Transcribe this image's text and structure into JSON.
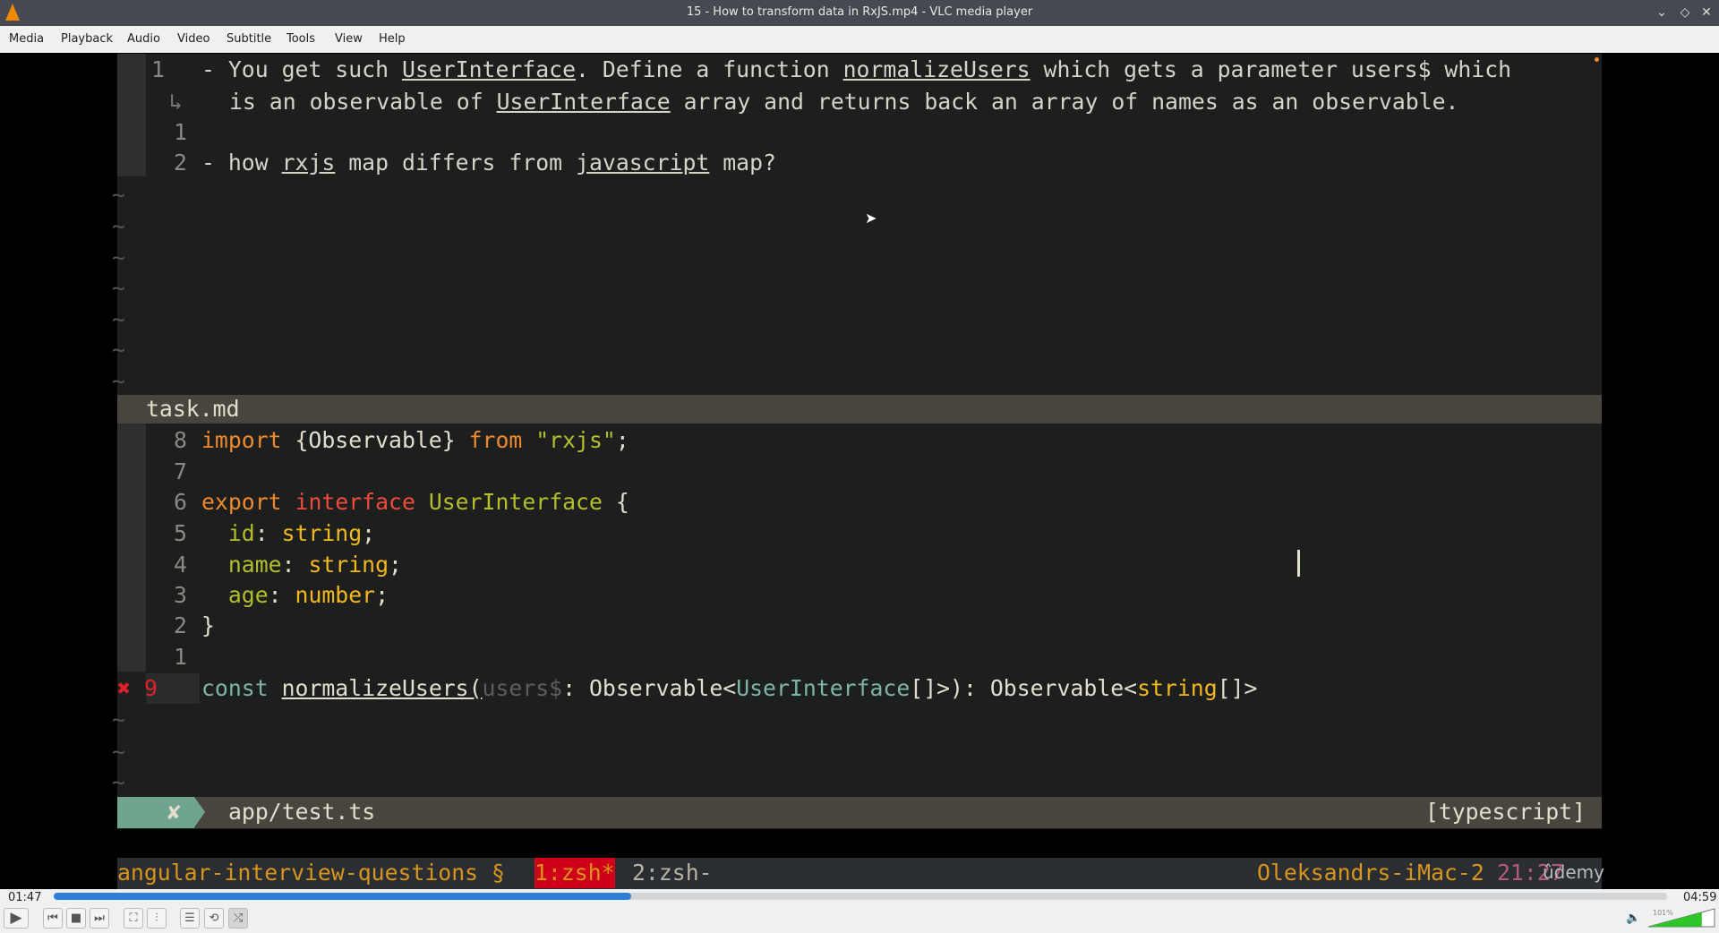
{
  "window": {
    "title": "15 - How to transform data in RxJS.mp4 - VLC media player"
  },
  "menu": [
    "Media",
    "Playback",
    "Audio",
    "Video",
    "Subtitle",
    "Tools",
    "View",
    "Help"
  ],
  "editor": {
    "top_pane": [
      {
        "num": "1",
        "tokens": [
          {
            "t": "- You get such ",
            "c": "#d6d3c8"
          },
          {
            "t": "UserInterface",
            "c": "#d6d3c8",
            "u": true
          },
          {
            "t": ". Define a function ",
            "c": "#d6d3c8"
          },
          {
            "t": "normalizeUsers",
            "c": "#d6d3c8",
            "u": true
          },
          {
            "t": " which gets a parameter users$ which",
            "c": "#d6d3c8"
          }
        ]
      },
      {
        "num": "",
        "wrap": "↳",
        "tokens": [
          {
            "t": "is an observable of ",
            "c": "#d6d3c8"
          },
          {
            "t": "UserInterface",
            "c": "#d6d3c8",
            "u": true
          },
          {
            "t": " array and returns back an array of names as an observable.",
            "c": "#d6d3c8"
          }
        ]
      },
      {
        "num": "1",
        "tokens": []
      },
      {
        "num": "2",
        "tokens": [
          {
            "t": "- how ",
            "c": "#d6d3c8"
          },
          {
            "t": "rxjs",
            "c": "#d6d3c8",
            "u": true
          },
          {
            "t": " map differs from ",
            "c": "#d6d3c8"
          },
          {
            "t": "javascript",
            "c": "#d6d3c8",
            "u": true
          },
          {
            "t": " map?",
            "c": "#d6d3c8"
          }
        ]
      }
    ],
    "top_status": "task.md",
    "code": [
      {
        "num": "8",
        "tokens": [
          {
            "t": "import",
            "c": "#f0892c"
          },
          {
            "t": " {Observable} ",
            "c": "#e2ddcc"
          },
          {
            "t": "from",
            "c": "#f0892c"
          },
          {
            "t": " \"rxjs\"",
            "c": "#b4be2a"
          },
          {
            "t": ";",
            "c": "#e2ddcc"
          }
        ]
      },
      {
        "num": "7",
        "tokens": []
      },
      {
        "num": "6",
        "tokens": [
          {
            "t": "export",
            "c": "#f0892c"
          },
          {
            "t": " ",
            "c": "#e2ddcc"
          },
          {
            "t": "interface",
            "c": "#f04a3a"
          },
          {
            "t": " ",
            "c": "#e2ddcc"
          },
          {
            "t": "UserInterface",
            "c": "#b4be2a"
          },
          {
            "t": " {",
            "c": "#e2ddcc"
          }
        ]
      },
      {
        "num": "5",
        "tokens": [
          {
            "t": "  id",
            "c": "#b4be2a"
          },
          {
            "t": ": ",
            "c": "#e2ddcc"
          },
          {
            "t": "string",
            "c": "#f2b81e"
          },
          {
            "t": ";",
            "c": "#e2ddcc"
          }
        ]
      },
      {
        "num": "4",
        "tokens": [
          {
            "t": "  name",
            "c": "#b4be2a"
          },
          {
            "t": ": ",
            "c": "#e2ddcc"
          },
          {
            "t": "string",
            "c": "#f2b81e"
          },
          {
            "t": ";",
            "c": "#e2ddcc"
          }
        ]
      },
      {
        "num": "3",
        "tokens": [
          {
            "t": "  age",
            "c": "#b4be2a"
          },
          {
            "t": ": ",
            "c": "#e2ddcc"
          },
          {
            "t": "number",
            "c": "#f2b81e"
          },
          {
            "t": ";",
            "c": "#e2ddcc"
          }
        ]
      },
      {
        "num": "2",
        "tokens": [
          {
            "t": "}",
            "c": "#e2ddcc"
          }
        ]
      },
      {
        "num": "1",
        "tokens": []
      },
      {
        "num": "9",
        "error": "✖",
        "tokens": [
          {
            "t": "const",
            "c": "#7fb3a8"
          },
          {
            "t": " ",
            "c": "#e2ddcc"
          },
          {
            "t": "normalizeUsers(",
            "c": "#e2ddcc",
            "u": true
          },
          {
            "t": "users$",
            "c": "#5c5e5c"
          },
          {
            "t": ": Observable<",
            "c": "#e2ddcc"
          },
          {
            "t": "UserInterface",
            "c": "#7fb3a8"
          },
          {
            "t": "[]>): Observable<",
            "c": "#e2ddcc"
          },
          {
            "t": "string",
            "c": "#f2b81e"
          },
          {
            "t": "[]>",
            "c": "#e2ddcc"
          }
        ]
      }
    ],
    "tilde": "~",
    "bottom_status": {
      "mode": "✘",
      "file": "app/test.ts",
      "filetype": "[typescript]"
    },
    "tmux": {
      "session": "angular-interview-questions §",
      "win1": "1:zsh*",
      "win2": "2:zsh-",
      "host": "Oleksandrs-iMac-2",
      "time": "21:27"
    },
    "watermark": "ûdemy"
  },
  "player": {
    "elapsed": "01:47",
    "total": "04:59",
    "progress": 0.358,
    "volume_label": "101%",
    "volume": 1.01
  },
  "colors": {
    "accent": "#2c7fd2",
    "volume": "#2fc42a",
    "error": "#e0202a"
  }
}
